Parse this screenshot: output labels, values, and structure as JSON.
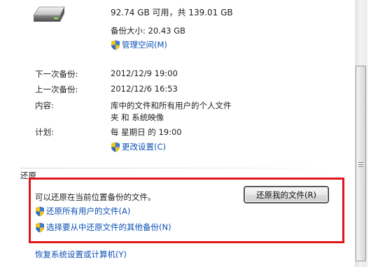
{
  "backup": {
    "free_space": "92.74 GB 可用，共 139.01 GB",
    "backup_size": "备份大小: 20.43 GB",
    "manage_space": "管理空间(M)",
    "next_label": "下一次备份:",
    "next_value": "2012/12/9 19:00",
    "last_label": "上一次备份:",
    "last_value": "2012/12/6 16:53",
    "contents_label": "内容:",
    "contents_line1": "库中的文件和所有用户的个人文件",
    "contents_line2": "夹 和 系统映像",
    "schedule_label": "计划:",
    "schedule_value": "每 星期日 的 19:00",
    "change_settings": "更改设置(C)"
  },
  "restore": {
    "heading": "还原",
    "description": "可以还原在当前位置备份的文件。",
    "restore_my_files": "还原我的文件(R)",
    "restore_all_users": "还原所有用户的文件(A)",
    "select_other_backup": "选择要从中还原文件的其他备份(N)",
    "recover_system": "恢复系统设置或计算机(Y)"
  },
  "colors": {
    "link": "#0b50b5",
    "highlight": "#e0161b"
  },
  "icons": {
    "drive": "drive-icon",
    "shield": "uac-shield-icon"
  }
}
